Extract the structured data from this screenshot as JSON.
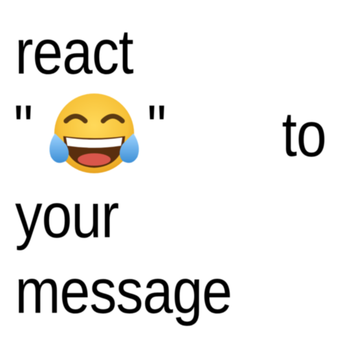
{
  "caption": {
    "line1": "react",
    "quote_open": "\"",
    "quote_close": "\"",
    "word_to": "to",
    "line3": "your",
    "line4": "message"
  },
  "emoji": {
    "icon": "face-with-tears-of-joy-icon",
    "face_color": "#f7c239",
    "tear_color": "#4fa6e6"
  }
}
